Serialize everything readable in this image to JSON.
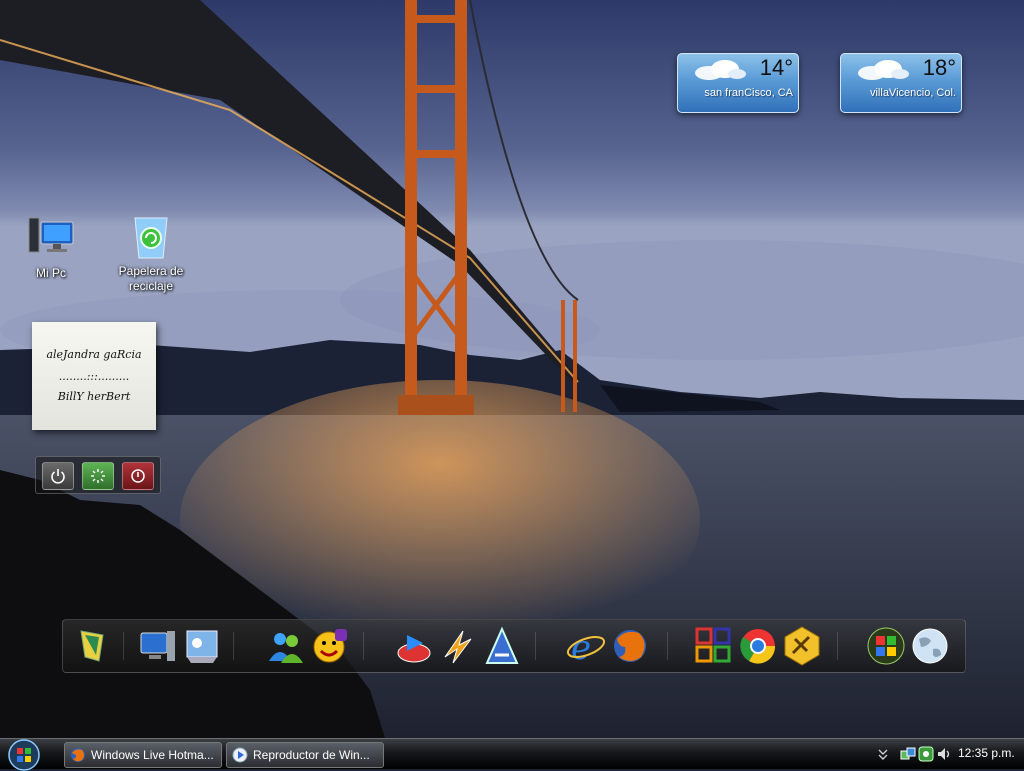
{
  "desktop": {
    "icons": [
      {
        "label": "Mi Pc",
        "icon": "computer-icon"
      },
      {
        "label": "Papelera de reciclaje",
        "icon": "recycle-bin-icon"
      }
    ]
  },
  "weather": [
    {
      "temp": "14°",
      "city": "san franCisco, CA"
    },
    {
      "temp": "18°",
      "city": "villaVicencio, Col."
    }
  ],
  "note": {
    "line1": "aleJandra gaRcia",
    "line2": "........:::.........",
    "line3": "BillY herBert"
  },
  "power_gadget": {
    "buttons": [
      "power-icon",
      "restart-icon",
      "shutdown-icon"
    ],
    "colors": {
      "power": "#5a5a5a",
      "restart": "#3f8a3a",
      "shutdown": "#8a1f24"
    }
  },
  "dock": {
    "items": [
      "rocketdock-icon",
      "my-computer-icon",
      "control-panel-icon",
      "messenger-icon",
      "yahoo-messenger-icon",
      "media-player-icon",
      "winamp-icon",
      "avant-icon",
      "internet-explorer-icon",
      "firefox-icon",
      "office-icon",
      "chrome-icon",
      "tools-icon",
      "windows-icon",
      "globe-icon"
    ]
  },
  "taskbar": {
    "tasks": [
      {
        "label": "Windows Live Hotma...",
        "icon": "firefox-icon"
      },
      {
        "label": "Reproductor de Win...",
        "icon": "media-player-icon"
      }
    ],
    "clock": "12:35 p.m."
  }
}
